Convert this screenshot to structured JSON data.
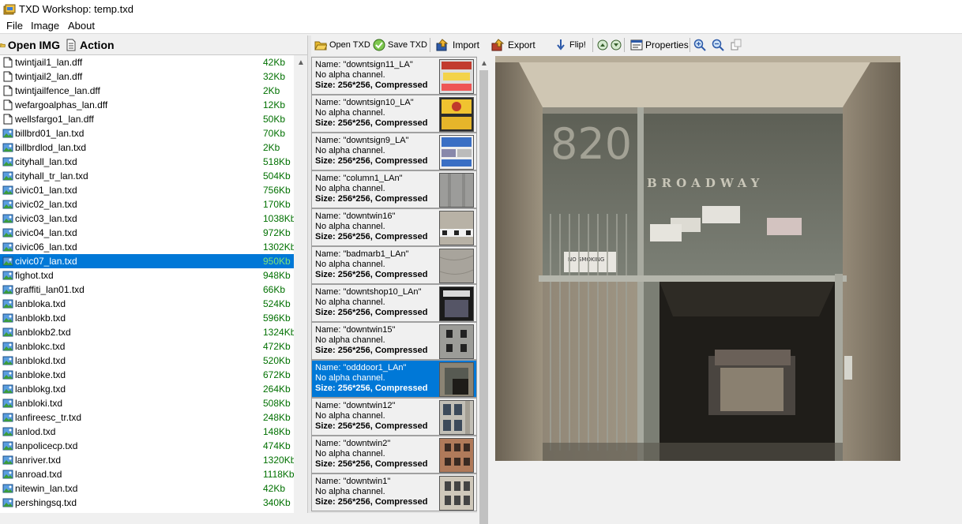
{
  "window": {
    "title": "TXD Workshop: temp.txd"
  },
  "menu": [
    "File",
    "Image",
    "About"
  ],
  "left_toolbar": {
    "open_img": "Open IMG",
    "action": "Action"
  },
  "files": [
    {
      "name": "twintjail1_lan.dff",
      "size": "42Kb",
      "type": "dff"
    },
    {
      "name": "twintjail2_lan.dff",
      "size": "32Kb",
      "type": "dff"
    },
    {
      "name": "twintjailfence_lan.dff",
      "size": "2Kb",
      "type": "dff"
    },
    {
      "name": "wefargoalphas_lan.dff",
      "size": "12Kb",
      "type": "dff"
    },
    {
      "name": "wellsfargo1_lan.dff",
      "size": "50Kb",
      "type": "dff"
    },
    {
      "name": "billbrd01_lan.txd",
      "size": "70Kb",
      "type": "txd"
    },
    {
      "name": "billbrdlod_lan.txd",
      "size": "2Kb",
      "type": "txd"
    },
    {
      "name": "cityhall_lan.txd",
      "size": "518Kb",
      "type": "txd"
    },
    {
      "name": "cityhall_tr_lan.txd",
      "size": "504Kb",
      "type": "txd"
    },
    {
      "name": "civic01_lan.txd",
      "size": "756Kb",
      "type": "txd"
    },
    {
      "name": "civic02_lan.txd",
      "size": "170Kb",
      "type": "txd"
    },
    {
      "name": "civic03_lan.txd",
      "size": "1038Kb",
      "type": "txd"
    },
    {
      "name": "civic04_lan.txd",
      "size": "972Kb",
      "type": "txd"
    },
    {
      "name": "civic06_lan.txd",
      "size": "1302Kb",
      "type": "txd"
    },
    {
      "name": "civic07_lan.txd",
      "size": "950Kb",
      "type": "txd",
      "selected": true
    },
    {
      "name": "fighot.txd",
      "size": "948Kb",
      "type": "txd"
    },
    {
      "name": "graffiti_lan01.txd",
      "size": "66Kb",
      "type": "txd"
    },
    {
      "name": "lanbloka.txd",
      "size": "524Kb",
      "type": "txd"
    },
    {
      "name": "lanblokb.txd",
      "size": "596Kb",
      "type": "txd"
    },
    {
      "name": "lanblokb2.txd",
      "size": "1324Kb",
      "type": "txd"
    },
    {
      "name": "lanblokc.txd",
      "size": "472Kb",
      "type": "txd"
    },
    {
      "name": "lanblokd.txd",
      "size": "520Kb",
      "type": "txd"
    },
    {
      "name": "lanbloke.txd",
      "size": "672Kb",
      "type": "txd"
    },
    {
      "name": "lanblokg.txd",
      "size": "264Kb",
      "type": "txd"
    },
    {
      "name": "lanbloki.txd",
      "size": "508Kb",
      "type": "txd"
    },
    {
      "name": "lanfireesc_tr.txd",
      "size": "248Kb",
      "type": "txd"
    },
    {
      "name": "lanlod.txd",
      "size": "148Kb",
      "type": "txd"
    },
    {
      "name": "lanpolicecp.txd",
      "size": "474Kb",
      "type": "txd"
    },
    {
      "name": "lanriver.txd",
      "size": "1320Kb",
      "type": "txd"
    },
    {
      "name": "lanroad.txd",
      "size": "1118Kb",
      "type": "txd"
    },
    {
      "name": "nitewin_lan.txd",
      "size": "42Kb",
      "type": "txd"
    },
    {
      "name": "pershingsq.txd",
      "size": "340Kb",
      "type": "txd"
    }
  ],
  "right_toolbar": {
    "open_txd": "Open TXD",
    "save_txd": "Save TXD",
    "import": "Import",
    "export": "Export",
    "flip": "Flip!",
    "properties": "Properties"
  },
  "textures": [
    {
      "name": "Name: \"downtsign11_LA\"",
      "alpha": "No alpha channel.",
      "size": "Size: 256*256, Compressed",
      "thumb": "sign-red"
    },
    {
      "name": "Name: \"downtsign10_LA\"",
      "alpha": "No alpha channel.",
      "size": "Size: 256*256, Compressed",
      "thumb": "sign-yellow"
    },
    {
      "name": "Name: \"downtsign9_LA\"",
      "alpha": "No alpha channel.",
      "size": "Size: 256*256, Compressed",
      "thumb": "sign-blue"
    },
    {
      "name": "Name: \"column1_LAn\"",
      "alpha": "No alpha channel.",
      "size": "Size: 256*256, Compressed",
      "thumb": "concrete"
    },
    {
      "name": "Name: \"downtwin16\"",
      "alpha": "No alpha channel.",
      "size": "Size: 256*256, Compressed",
      "thumb": "wall-windows"
    },
    {
      "name": "Name: \"badmarb1_LAn\"",
      "alpha": "No alpha channel.",
      "size": "Size: 256*256, Compressed",
      "thumb": "marble"
    },
    {
      "name": "Name: \"downtshop10_LAn\"",
      "alpha": "No alpha channel.",
      "size": "Size: 256*256, Compressed",
      "thumb": "shopfront"
    },
    {
      "name": "Name: \"downtwin15\"",
      "alpha": "No alpha channel.",
      "size": "Size: 256*256, Compressed",
      "thumb": "wall-dark-windows"
    },
    {
      "name": "Name: \"odddoor1_LAn\"",
      "alpha": "No alpha channel.",
      "size": "Size: 256*256, Compressed",
      "thumb": "doorway",
      "selected": true
    },
    {
      "name": "Name: \"downtwin12\"",
      "alpha": "No alpha channel.",
      "size": "Size: 256*256, Compressed",
      "thumb": "facade-grey"
    },
    {
      "name": "Name: \"downtwin2\"",
      "alpha": "No alpha channel.",
      "size": "Size: 256*256, Compressed",
      "thumb": "facade-brick"
    },
    {
      "name": "Name: \"downtwin1\"",
      "alpha": "No alpha channel.",
      "size": "Size: 256*256, Compressed",
      "thumb": "facade-stone"
    }
  ],
  "preview": {
    "number": "820",
    "street": "BROADWAY",
    "sign": "NO SMOKING"
  },
  "colors": {
    "selection": "#0078d7",
    "size_text": "#007000"
  }
}
